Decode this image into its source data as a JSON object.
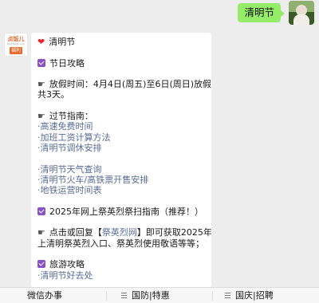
{
  "outgoing": {
    "text": "清明节"
  },
  "bot": {
    "avatar_top": "点饭儿",
    "avatar_mid": "DianFanEr.com",
    "avatar_tag": "福利"
  },
  "card": {
    "title": "清明节",
    "section1": "节日攻略",
    "holiday_line1": "放假时间：4月4日(周五)至6日(周日)放假，",
    "holiday_line2": "共3天。",
    "guide_title": "过节指南：",
    "links_a": [
      "·高速免费时间",
      "·加班工资计算方法",
      "·清明节调休安排"
    ],
    "links_b": [
      "·清明节天气查询",
      "·清明节火车/高铁票开售安排",
      "·地铁运营时间表"
    ],
    "section2": "2025年网上祭英烈祭扫指南（推荐！）",
    "reply_prefix": "点击或回复【",
    "reply_link": "祭英烈网",
    "reply_suffix": "】即可获取2025年网",
    "reply_line2": "上清明祭英烈入口、祭英烈使用敬语等等；",
    "section3": "旅游攻略",
    "links_c": [
      "·清明节好去处"
    ]
  },
  "menu": {
    "items": [
      "微信办事",
      "国防|特惠",
      "国庆|招聘"
    ]
  }
}
